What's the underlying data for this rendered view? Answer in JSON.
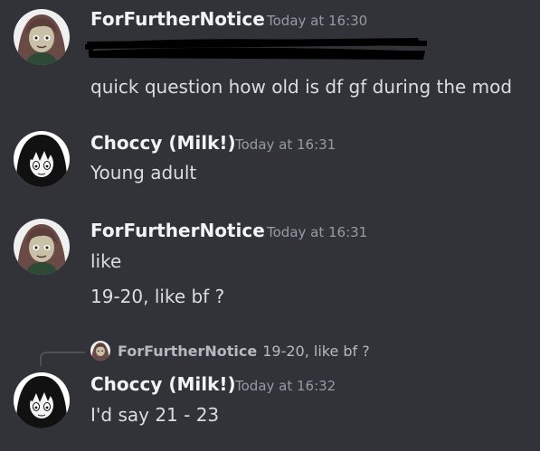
{
  "messages": [
    {
      "author": "ForFurtherNotice",
      "timestamp": "Today at 16:30",
      "avatar_icon": "brown-haired-character-avatar",
      "lines": [
        "quick question how old is df gf during the mod"
      ],
      "has_redacted_line": true
    },
    {
      "author": "Choccy (Milk!)",
      "timestamp": "Today at 16:31",
      "avatar_icon": "black-haired-pale-character-avatar",
      "lines": [
        "Young adult"
      ]
    },
    {
      "author": "ForFurtherNotice",
      "timestamp": "Today at 16:31",
      "avatar_icon": "brown-haired-character-avatar",
      "lines": [
        "like",
        "19-20, like bf ?"
      ]
    },
    {
      "author": "Choccy (Milk!)",
      "timestamp": "Today at 16:32",
      "avatar_icon": "black-haired-pale-character-avatar",
      "reply": {
        "author": "ForFurtherNotice",
        "text": "19-20, like bf ?"
      },
      "lines": [
        "I'd say 21 - 23"
      ]
    }
  ],
  "colors": {
    "background": "#313338",
    "username": "#f2f3f5",
    "timestamp": "#949ba4",
    "message_text": "#dbdee1",
    "reply_spine": "#4e5058"
  }
}
